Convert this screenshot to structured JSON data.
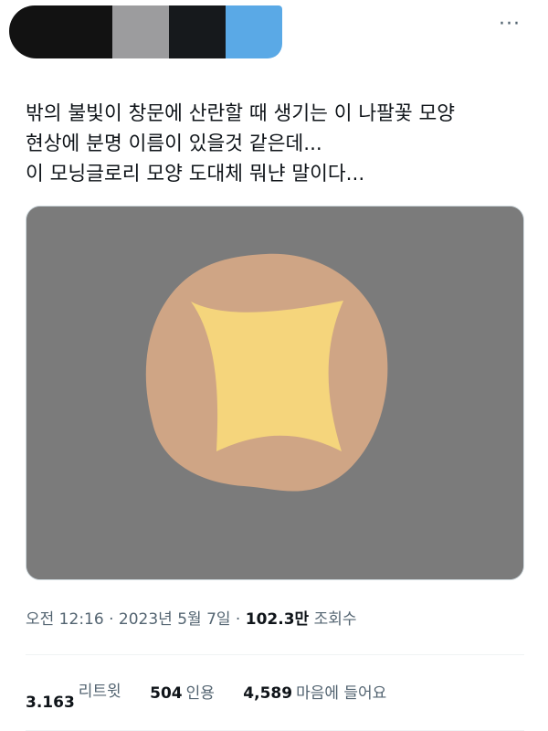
{
  "header": {
    "more_icon": "more-horizontal-icon",
    "more_label": "···"
  },
  "tweet": {
    "lines": [
      "밖의 불빛이 창문에 산란할 때 생기는 이 나팔꽃 모양",
      "현상에 분명 이름이 있을것 같은데...",
      "이 모닝글로리 모양 도대체 뭐냔 말이다..."
    ]
  },
  "media": {
    "background_color": "#7b7b7b",
    "circle_color": "#cfa585",
    "star_color": "#f5d57c"
  },
  "meta": {
    "time": "오전 12:16",
    "sep1": " · ",
    "date": "2023년 5월 7일",
    "sep2": " · ",
    "views": "102.3만",
    "views_label": " 조회수"
  },
  "stats": {
    "retweets": "3.163",
    "retweets_label": "리트윗",
    "quotes": "504",
    "quotes_label": "인용",
    "likes": "4,589",
    "likes_label": "마음에 들어요"
  }
}
